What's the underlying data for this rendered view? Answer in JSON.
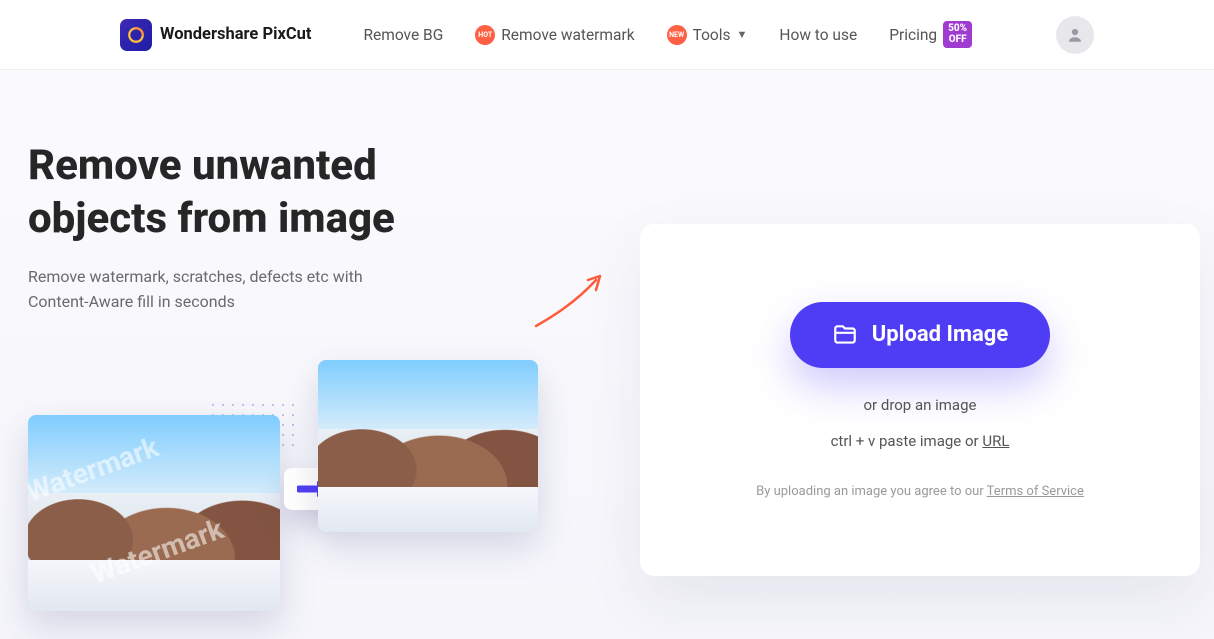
{
  "header": {
    "brand": "Wondershare PixCut",
    "nav": {
      "remove_bg": "Remove BG",
      "remove_wm": "Remove watermark",
      "hot": "HOT",
      "tools": "Tools",
      "new": "NEW",
      "how": "How to use",
      "pricing": "Pricing",
      "off_badge": "50%\nOFF"
    }
  },
  "hero": {
    "title_line1": "Remove unwanted",
    "title_line2": "objects from image",
    "subtitle": "Remove watermark, scratches, defects etc with Content-Aware fill in seconds",
    "watermark_text": "Watermark"
  },
  "panel": {
    "upload_label": "Upload Image",
    "drop_text": "or drop an image",
    "paste_prefix": "ctrl + v paste image or ",
    "url_text": "URL",
    "tos_prefix": "By uploading an image you agree to our ",
    "tos_link": "Terms of Service"
  }
}
